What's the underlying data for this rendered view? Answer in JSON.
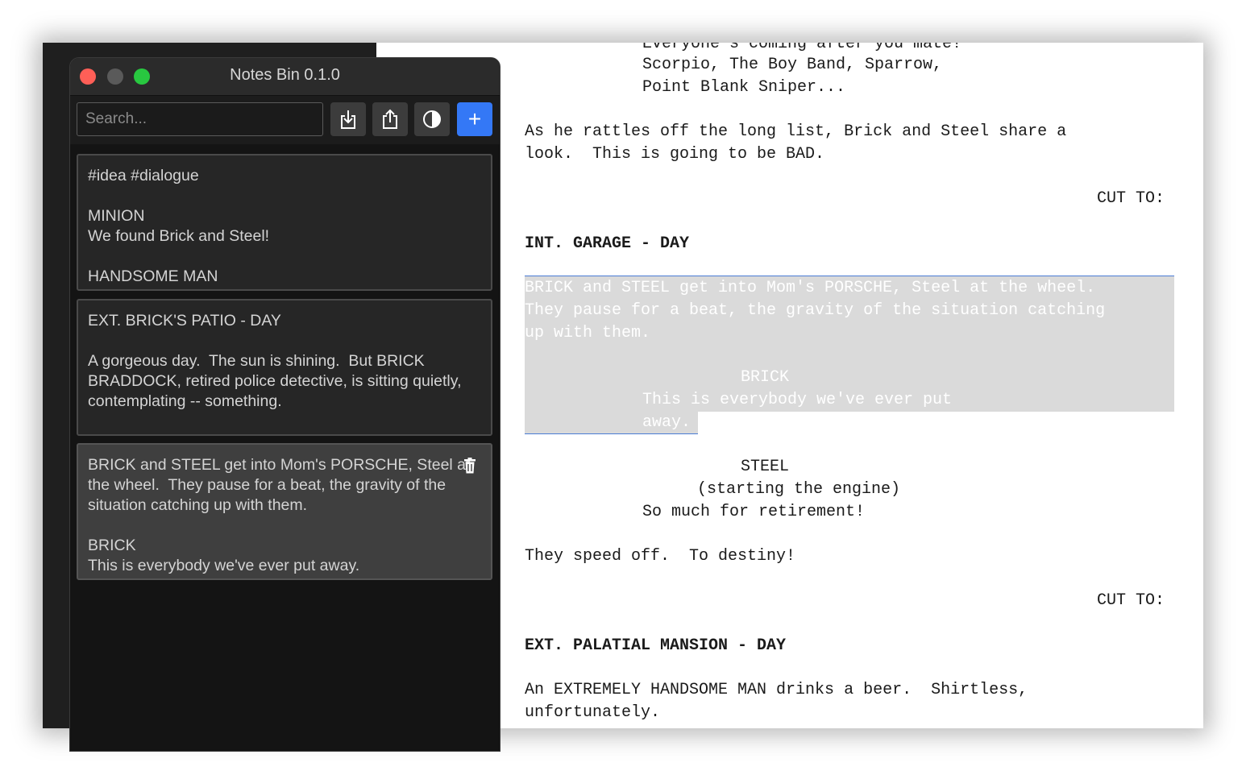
{
  "app": {
    "title": "Notes Bin 0.1.0",
    "search_placeholder": "Search...",
    "buttons": {
      "import_icon": "import-icon",
      "export_icon": "share-icon",
      "theme_icon": "contrast-icon",
      "add_label": "+"
    },
    "notes": [
      {
        "text": "#idea #dialogue\n\nMINION\nWe found Brick and Steel!\n\nHANDSOME MAN"
      },
      {
        "text": "EXT. BRICK'S PATIO - DAY\n\nA gorgeous day.  The sun is shining.  But BRICK BRADDOCK, retired police detective, is sitting quietly, contemplating -- something."
      },
      {
        "text": "BRICK and STEEL get into Mom's PORSCHE, Steel at the wheel.  They pause for a beat, the gravity of the situation catching up with them.\n\nBRICK\nThis is everybody we've ever put away."
      }
    ],
    "accent_color": "#3478f6"
  },
  "script": {
    "lines": [
      "Everyone's coming after you mate!",
      "Scorpio, The Boy Band, Sparrow,",
      "Point Blank Sniper...",
      "As he rattles off the long list, Brick and Steel share a",
      "look.  This is going to be BAD.",
      "CUT TO:",
      "INT. GARAGE - DAY",
      "BRICK and STEEL get into Mom's PORSCHE, Steel at the wheel.",
      "They pause for a beat, the gravity of the situation catching",
      "up with them.",
      "BRICK",
      "This is everybody we've ever put",
      "away.",
      "STEEL",
      "(starting the engine)",
      "So much for retirement!",
      "They speed off.  To destiny!",
      "CUT TO:",
      "EXT. PALATIAL MANSION - DAY",
      "An EXTREMELY HANDSOME MAN drinks a beer.  Shirtless,",
      "unfortunately."
    ]
  }
}
